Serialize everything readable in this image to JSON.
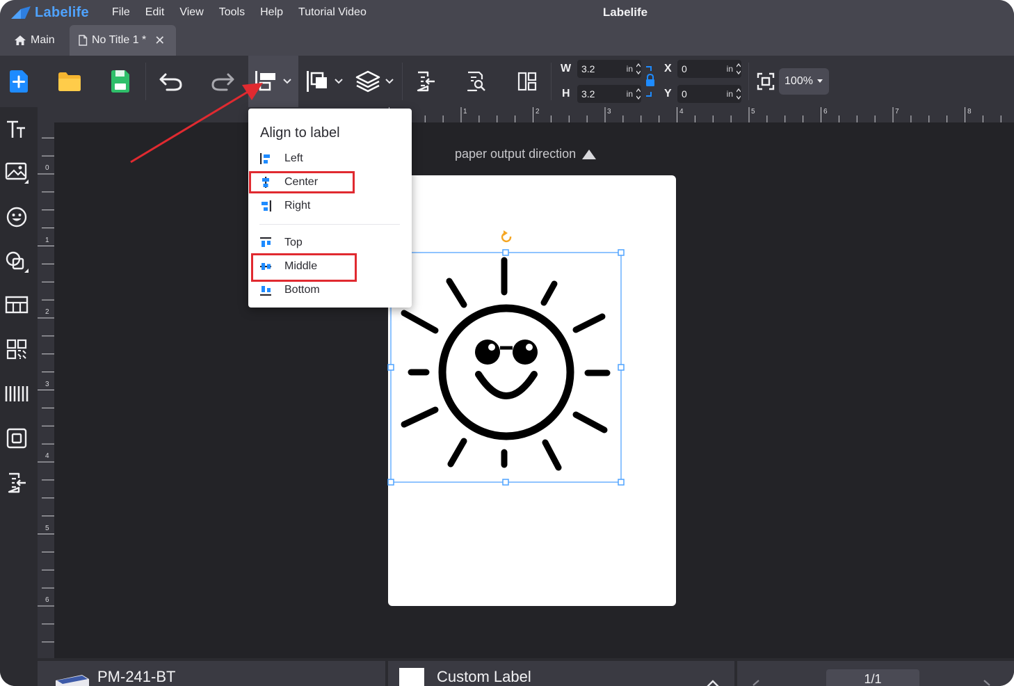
{
  "app": {
    "brand": "Labelife",
    "window_title": "Labelife",
    "accent_color": "#4fa3ff",
    "highlight_color": "#e02a30"
  },
  "menu": [
    "File",
    "Edit",
    "View",
    "Tools",
    "Help",
    "Tutorial Video"
  ],
  "tabs": {
    "main_label": "Main",
    "doc_label": "No Title 1 *",
    "close_symbol": "✕"
  },
  "toolbar": {
    "width_label": "W",
    "height_label": "H",
    "x_label": "X",
    "y_label": "Y",
    "width_value": "3.2",
    "height_value": "3.2",
    "x_value": "0",
    "y_value": "0",
    "unit": "in",
    "zoom": "100%"
  },
  "ruler": {
    "top_numbers": [
      "1",
      "2",
      "3",
      "4",
      "5",
      "6",
      "7",
      "8"
    ],
    "left_numbers": [
      "0",
      "1",
      "2",
      "3",
      "4",
      "5",
      "6"
    ]
  },
  "canvas": {
    "direction_label": "paper output direction"
  },
  "align_menu": {
    "title": "Align to label",
    "horizontal": [
      "Left",
      "Center",
      "Right"
    ],
    "vertical": [
      "Top",
      "Middle",
      "Bottom"
    ],
    "highlighted": [
      "Center",
      "Middle"
    ]
  },
  "status": {
    "printer": "PM-241-BT",
    "label": "Custom Label",
    "page": "1/1"
  }
}
